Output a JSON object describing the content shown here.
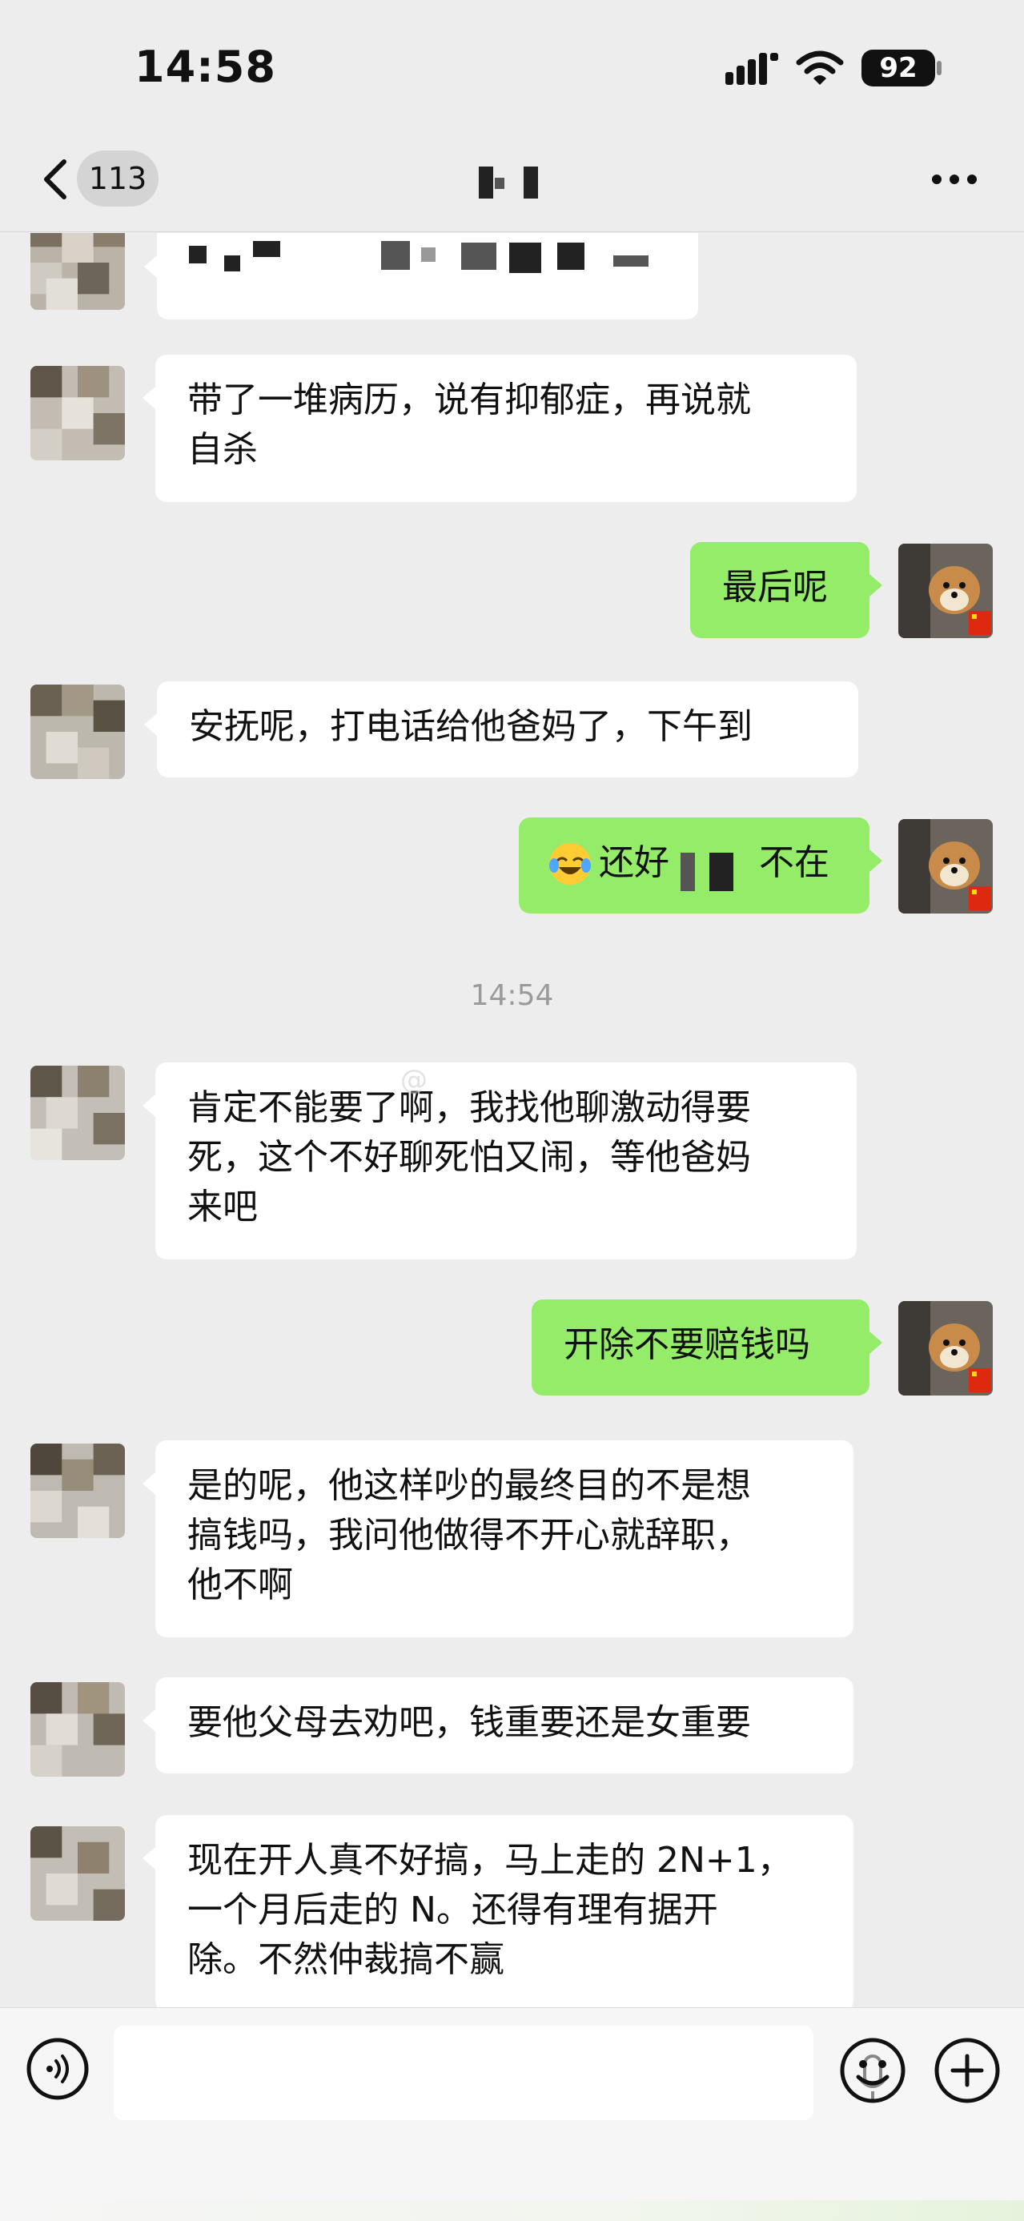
{
  "status_bar": {
    "time": "14:58",
    "battery": "92"
  },
  "nav": {
    "unread_count": "113"
  },
  "messages": [
    {
      "side": "in",
      "text": "带了一堆病历，说有抑郁症，再说就\n自杀"
    },
    {
      "side": "out",
      "text": "最后呢"
    },
    {
      "side": "in",
      "text": "安抚呢，打电话给他爸妈了，下午到"
    },
    {
      "side": "out",
      "text": "还好",
      "suffix": "不在"
    },
    {
      "side": "in",
      "text": "肯定不能要了啊，我找他聊激动得要\n死，这个不好聊死怕又闹，等他爸妈\n来吧"
    },
    {
      "side": "out",
      "text": "开除不要赔钱吗"
    },
    {
      "side": "in",
      "text": "是的呢，他这样吵的最终目的不是想\n搞钱吗，我问他做得不开心就辞职，\n他不啊"
    },
    {
      "side": "in",
      "text": "要他父母去劝吧，钱重要还是女重要"
    },
    {
      "side": "in",
      "text": "现在开人真不好搞，马上走的 2N+1，\n一个月后走的 N。还得有理有据开\n除。不然仲裁搞不赢"
    }
  ],
  "timestamp": "14:54",
  "colors": {
    "background": "#ededed",
    "incoming_bubble": "#ffffff",
    "outgoing_bubble": "#95ec69",
    "timestamp_text": "#9a9a9a"
  },
  "icons": [
    "back-icon",
    "more-icon",
    "signal-icon",
    "wifi-icon",
    "voice-icon",
    "mic-icon",
    "emoji-icon",
    "plus-icon",
    "crying-laughing-emoji-icon"
  ]
}
